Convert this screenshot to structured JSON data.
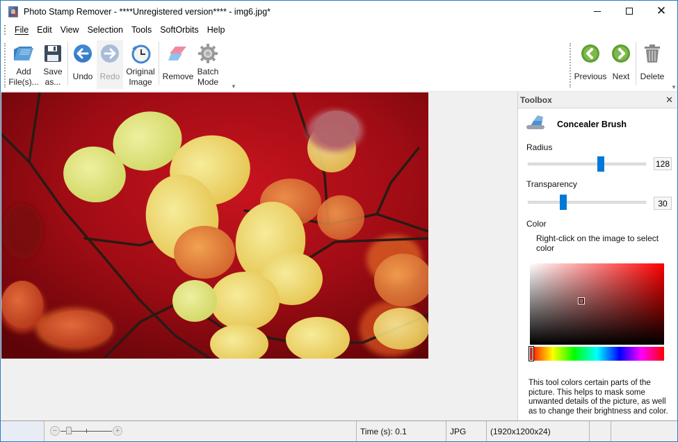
{
  "window": {
    "title": "Photo Stamp Remover - ****Unregistered version**** - img6.jpg*",
    "controls": {
      "minimize": "minimize",
      "maximize": "maximize",
      "close": "close"
    }
  },
  "menu": {
    "items": [
      {
        "label": "File",
        "accel": "F"
      },
      {
        "label": "Edit",
        "accel": "E"
      },
      {
        "label": "View",
        "accel": "V"
      },
      {
        "label": "Selection",
        "accel": "S"
      },
      {
        "label": "Tools",
        "accel": "T"
      },
      {
        "label": "SoftOrbits",
        "accel": ""
      },
      {
        "label": "Help",
        "accel": "H"
      }
    ]
  },
  "toolbar": {
    "add_files": {
      "label": "Add\nFile(s)...",
      "icon": "folder-open-icon"
    },
    "save_as": {
      "label": "Save\nas...",
      "icon": "floppy-disk-icon"
    },
    "undo": {
      "label": "Undo",
      "icon": "arrow-left-circle-icon"
    },
    "redo": {
      "label": "Redo",
      "icon": "arrow-right-circle-icon",
      "disabled": true
    },
    "original_image": {
      "label": "Original\nImage",
      "icon": "clock-restore-icon"
    },
    "remove": {
      "label": "Remove",
      "icon": "eraser-icon"
    },
    "batch_mode": {
      "label": "Batch\nMode",
      "icon": "gear-icon"
    },
    "previous": {
      "label": "Previous",
      "icon": "green-left-chevron-icon"
    },
    "next": {
      "label": "Next",
      "icon": "green-right-chevron-icon"
    },
    "delete": {
      "label": "Delete",
      "icon": "trash-icon"
    }
  },
  "image": {
    "description": "Autumn leaves: yellow and orange leaves on dark branches against a red background, with a pinkish concealer brush patch at top-right"
  },
  "toolbox": {
    "title": "Toolbox",
    "tool_name": "Concealer Brush",
    "radius": {
      "label": "Radius",
      "value": "128",
      "fraction": 0.62
    },
    "transparency": {
      "label": "Transparency",
      "value": "30",
      "fraction": 0.3
    },
    "color": {
      "label": "Color",
      "hint": "Right-click on the image to select color",
      "selected_hex": "#b2514f",
      "hue_hex": "#ff0000"
    },
    "description": "This tool colors certain parts of the picture. This helps to mask some unwanted details of the picture, as well as to change their brightness and color."
  },
  "status": {
    "time": "Time (s): 0.1",
    "format": "JPG",
    "dimensions": "(1920x1200x24)",
    "zoom_minus": "−",
    "zoom_plus": "+"
  },
  "colors": {
    "accent": "#0078d7",
    "window_border": "#2b79c2",
    "nav_green": "#6aaa3a"
  }
}
